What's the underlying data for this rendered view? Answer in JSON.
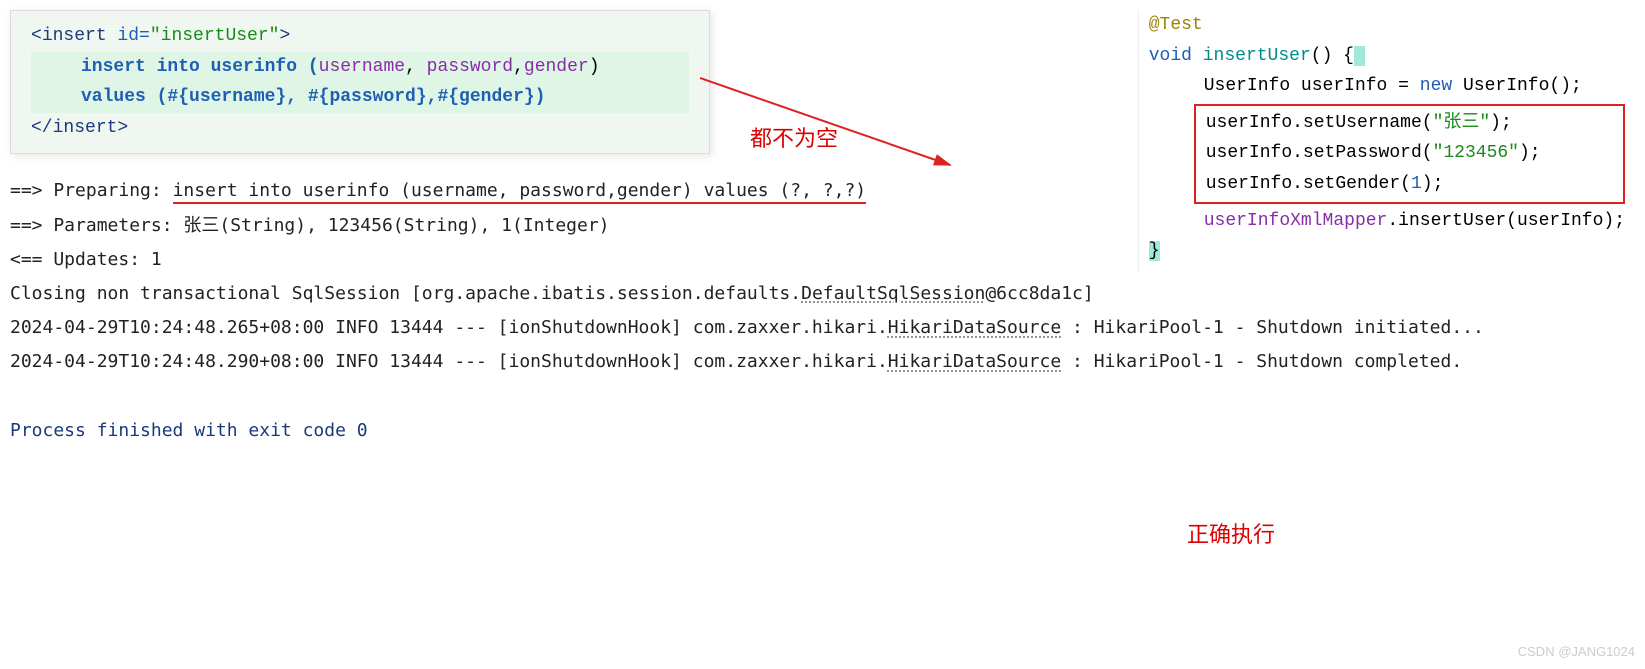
{
  "xml": {
    "open_bracket": "<",
    "tag": "insert",
    "attr_id": " id=",
    "attr_val": "\"insertUser\"",
    "close_bracket": ">",
    "line2_a": "insert into userinfo (",
    "line2_b": "username",
    "line2_c": ", ",
    "line2_d": "password",
    "line2_e": ",",
    "line2_f": "gender",
    "line2_g": ")",
    "line3": "values (#{username}, #{password},#{gender})",
    "close_open": "</",
    "close_tag": "insert",
    "close_close": ">"
  },
  "java": {
    "anno": "@Test",
    "void": "void ",
    "method": "insertUser",
    "paren_brace": "() {",
    "line1a": "UserInfo userInfo = ",
    "line1b": "new ",
    "line1c": "UserInfo();",
    "box1a": "userInfo.setUsername(",
    "box1b": "\"张三\"",
    "box1c": ");",
    "box2a": "userInfo.setPassword(",
    "box2b": "\"123456\"",
    "box2c": ");",
    "box3a": "userInfo.setGender(",
    "box3b": "1",
    "box3c": ");",
    "line5a": "userInfoXmlMapper",
    "line5b": ".insertUser(userInfo);",
    "closebrace": "}"
  },
  "annotations": {
    "center": "都不为空",
    "right": "正确执行"
  },
  "console": {
    "l1a": "==>  Preparing: ",
    "l1b": "insert into userinfo (username, password,gender) values (?, ?,?)",
    "l2": "==> Parameters: 张三(String), 123456(String), 1(Integer)",
    "l3": "<==    Updates: 1",
    "l4a": "Closing non transactional SqlSession [org.apache.ibatis.session.defaults.",
    "l4b": "DefaultSqlSession",
    "l4c": "@6cc8da1c]",
    "l5a": "2024-04-29T10:24:48.265+08:00  INFO 13444 --- [ionShutdownHook] com.zaxxer.hikari.",
    "l5b": "HikariDataSource",
    "l5c": "     : HikariPool-1 - Shutdown initiated...",
    "l6a": "2024-04-29T10:24:48.290+08:00  INFO 13444 --- [ionShutdownHook] com.zaxxer.hikari.",
    "l6b": "HikariDataSource",
    "l6c": "     : HikariPool-1 - Shutdown completed.",
    "l7": "Process finished with exit code 0"
  },
  "watermark": "CSDN @JANG1024"
}
